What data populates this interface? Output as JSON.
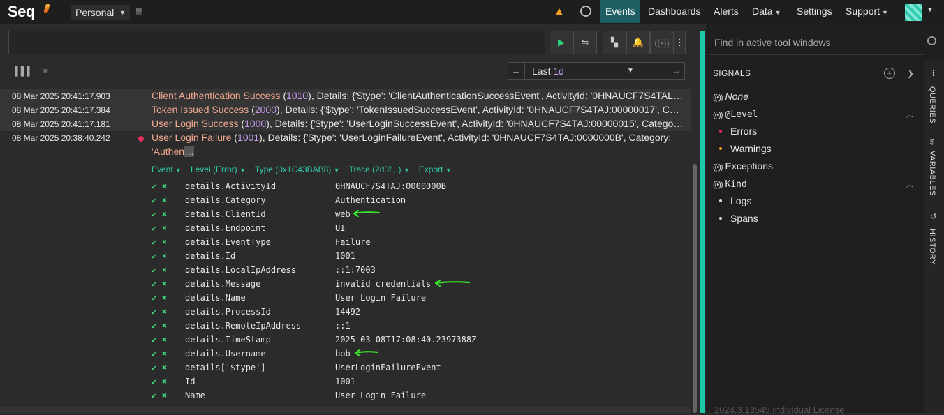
{
  "app": {
    "logo": "Seq",
    "workspace": "Personal"
  },
  "nav": {
    "items": [
      "Events",
      "Dashboards",
      "Alerts",
      "Data",
      "Settings",
      "Support"
    ],
    "active": "Events"
  },
  "toolbar": {
    "range_label": "Last",
    "range_value": "1d"
  },
  "events": [
    {
      "ts": "08 Mar 2025  20:41:17.903",
      "name": "Client Authentication Success",
      "id": "1010",
      "rest": ", Details: {'$type': 'ClientAuthenticationSuccessEvent', ActivityId: '0HNAUCF7S4TAL:..."
    },
    {
      "ts": "08 Mar 2025  20:41:17.384",
      "name": "Token Issued Success",
      "id": "2000",
      "rest": ", Details: {'$type': 'TokenIssuedSuccessEvent', ActivityId: '0HNAUCF7S4TAJ:00000017', Cate..."
    },
    {
      "ts": "08 Mar 2025  20:41:17.181",
      "name": "User Login Success",
      "id": "1000",
      "rest": ", Details: {'$type': 'UserLoginSuccessEvent', ActivityId: '0HNAUCF7S4TAJ:00000015', Category: ..."
    },
    {
      "ts": "08 Mar 2025  20:38:40.242",
      "name": "User Login Failure",
      "id": "1001",
      "rest": ", Details: {'$type': 'UserLoginFailureEvent', ActivityId: '0HNAUCF7S4TAJ:0000000B', Category:",
      "rest2": "'Authen"
    }
  ],
  "detail_links": [
    "Event",
    "Level (Error)",
    "Type (0x1C43BAB8)",
    "Trace (2d3f...)",
    "Export"
  ],
  "properties": [
    {
      "k": "details.ActivityId",
      "v": "0HNAUCF7S4TAJ:0000000B"
    },
    {
      "k": "details.Category",
      "v": "Authentication"
    },
    {
      "k": "details.ClientId",
      "v": "web"
    },
    {
      "k": "details.Endpoint",
      "v": "UI"
    },
    {
      "k": "details.EventType",
      "v": "Failure"
    },
    {
      "k": "details.Id",
      "v": "1001"
    },
    {
      "k": "details.LocalIpAddress",
      "v": "::1:7003"
    },
    {
      "k": "details.Message",
      "v": "invalid credentials"
    },
    {
      "k": "details.Name",
      "v": "User Login Failure"
    },
    {
      "k": "details.ProcessId",
      "v": "14492"
    },
    {
      "k": "details.RemoteIpAddress",
      "v": "::1"
    },
    {
      "k": "details.TimeStamp",
      "v": "2025-03-08T17:08:40.2397388Z"
    },
    {
      "k": "details.Username",
      "v": "bob"
    },
    {
      "k": "details['$type']",
      "v": "UserLoginFailureEvent"
    },
    {
      "k": "Id",
      "v": "1001"
    },
    {
      "k": "Name",
      "v": "User Login Failure"
    }
  ],
  "right": {
    "find_placeholder": "Find in active tool windows",
    "signals_title": "SIGNALS",
    "signals": {
      "none": "None",
      "level": "@Level",
      "errors": "Errors",
      "warnings": "Warnings",
      "exceptions": "Exceptions",
      "kind": "Kind",
      "logs": "Logs",
      "spans": "Spans"
    },
    "version": "2024.3.13545  Individual License"
  },
  "vtabs": [
    "QUERIES",
    "VARIABLES",
    "HISTORY"
  ]
}
